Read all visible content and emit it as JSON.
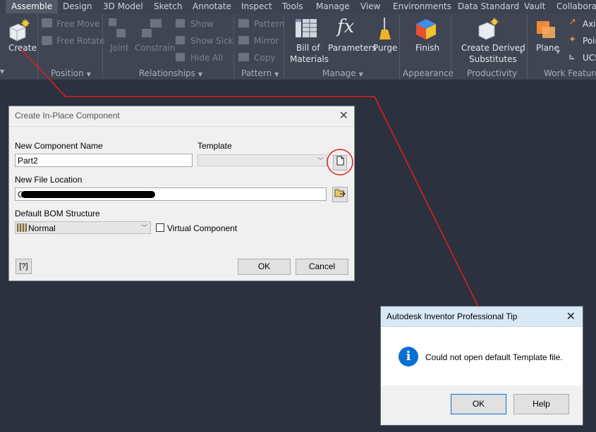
{
  "tabs": [
    "Assemble",
    "Design",
    "3D Model",
    "Sketch",
    "Annotate",
    "Inspect",
    "Tools",
    "Manage",
    "View",
    "Environments",
    "Data Standard",
    "Vault",
    "Collaborat"
  ],
  "ribbon": {
    "create": "Create",
    "free_move": "Free Move",
    "free_rotate": "Free Rotate",
    "joint": "Joint",
    "constrain": "Constrain",
    "show": "Show",
    "show_sick": "Show Sick",
    "hide_all": "Hide All",
    "pattern": "Pattern",
    "mirror": "Mirror",
    "copy": "Copy",
    "bom_line1": "Bill of",
    "bom_line2": "Materials",
    "parameters": "Parameters",
    "purge": "Purge",
    "finish": "Finish",
    "create_derived_line1": "Create Derived",
    "create_derived_line2": "Substitutes",
    "plane": "Plane",
    "axis": "Axis",
    "point": "Poin",
    "ucs": "UCS",
    "panels": {
      "position": "Position",
      "relationships": "Relationships",
      "pattern": "Pattern",
      "manage": "Manage",
      "appearance": "Appearance",
      "productivity": "Productivity",
      "work_features": "Work Features"
    }
  },
  "dialog": {
    "title": "Create In-Place Component",
    "name_label": "New Component Name",
    "name_value": "Part2",
    "template_label": "Template",
    "location_label": "New File Location",
    "location_value": "C:\\",
    "bom_label": "Default BOM Structure",
    "bom_value": "Normal",
    "virtual_label": "Virtual Component",
    "ok": "OK",
    "cancel": "Cancel"
  },
  "tip": {
    "title": "Autodesk Inventor Professional Tip",
    "message": "Could not open default Template file.",
    "ok": "OK",
    "help": "Help"
  },
  "colors": {
    "annotation": "#e0201c",
    "info_blue": "#0a6fd4",
    "background": "#2b313f",
    "ribbon": "#3f4553"
  }
}
